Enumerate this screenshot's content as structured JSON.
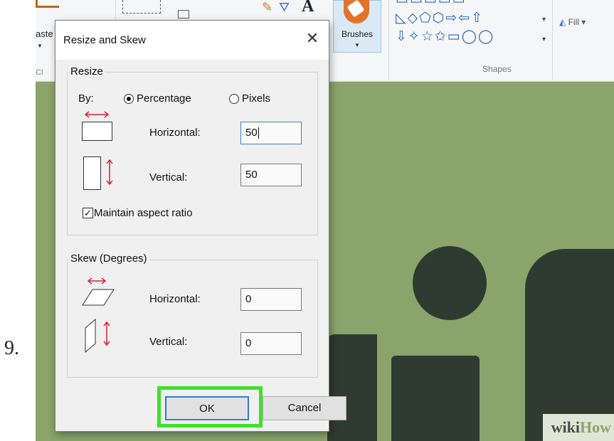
{
  "step_number": "9.",
  "ribbon": {
    "paste_label": "aste",
    "clipboard_label": "Cl",
    "text_tool": "A",
    "brushes_label": "Brushes",
    "shapes_label": "Shapes",
    "fill_label": "Fill",
    "shape_rows": [
      "◺◇⬠⬡⇨⇦⇧",
      "⇩✧☆✩▭◯◯"
    ]
  },
  "dialog": {
    "title": "Resize and Skew",
    "close_glyph": "✕",
    "resize": {
      "legend": "Resize",
      "by_label": "By:",
      "options": {
        "percentage": "Percentage",
        "pixels": "Pixels"
      },
      "selected": "percentage",
      "horizontal_label": "Horizontal:",
      "horizontal_value": "50",
      "vertical_label": "Vertical:",
      "vertical_value": "50",
      "maintain_label": "Maintain aspect ratio",
      "maintain_checked": true
    },
    "skew": {
      "legend": "Skew (Degrees)",
      "horizontal_label": "Horizontal:",
      "horizontal_value": "0",
      "vertical_label": "Vertical:",
      "vertical_value": "0"
    },
    "buttons": {
      "ok": "OK",
      "cancel": "Cancel"
    }
  },
  "watermark": {
    "part1": "wiki",
    "part2": "How"
  },
  "colors": {
    "canvas": "#8aa46b",
    "letters": "#2f3a31",
    "highlight": "#3fe02c",
    "arrow_red": "#d6213a",
    "focus_blue": "#2f7cd6"
  }
}
